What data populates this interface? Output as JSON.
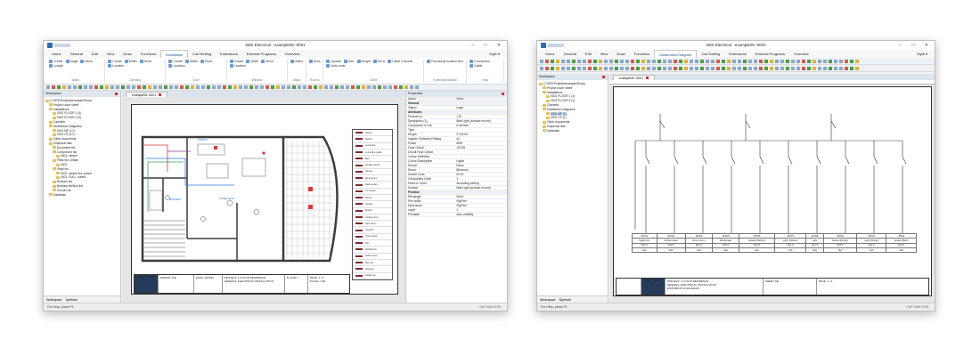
{
  "window_a": {
    "title": "SEE Electrical - example05 -0001",
    "window_controls": "– □ ✕",
    "menu": [
      {
        "label": "Home",
        "active": false
      },
      {
        "label": "General",
        "active": false
      },
      {
        "label": "Edit",
        "active": false
      },
      {
        "label": "View",
        "active": false
      },
      {
        "label": "Draw",
        "active": false
      },
      {
        "label": "Functions",
        "active": false
      },
      {
        "label": "Installation",
        "active": true
      },
      {
        "label": "Cad Setting",
        "active": false
      },
      {
        "label": "Extensions",
        "active": false
      },
      {
        "label": "External Programs",
        "active": false
      },
      {
        "label": "Overview",
        "active": false
      }
    ],
    "style_label": "Style ▾",
    "ribbon_groups": [
      {
        "label": "Walls",
        "buttons": [
          "Create",
          "Angle",
          "Move",
          "Length"
        ]
      },
      {
        "label": "Opening",
        "buttons": [
          "Create",
          "Width",
          "Move",
          "Location"
        ]
      },
      {
        "label": "Door",
        "buttons": [
          "Create",
          "Width",
          "Move",
          "Location"
        ]
      },
      {
        "label": "Window",
        "buttons": [
          "Create",
          "Width",
          "Move",
          "Location"
        ]
      },
      {
        "label": "Stairs",
        "buttons": [
          "Stairs"
        ]
      },
      {
        "label": "Rooms",
        "buttons": [
          "Area"
        ]
      },
      {
        "label": "Cable",
        "buttons": [
          "Update",
          "Size",
          "Height",
          "Set A",
          "Cable Channel",
          "Auto route"
        ]
      },
      {
        "label": "Functional location",
        "buttons": [
          "Functional location Box"
        ]
      },
      {
        "label": "View",
        "buttons": [
          "Connection",
          "Cable"
        ]
      }
    ],
    "workspace": {
      "title": "Workspace",
      "tree": [
        {
          "label": "C:\\SEE\\Projects\\example05.sep",
          "level": 0,
          "selected": false
        },
        {
          "label": "Project cover sheet",
          "level": 1,
          "selected": false
        },
        {
          "label": "Installations",
          "level": 1,
          "selected": false
        },
        {
          "label": "0001 FLOOR 1 (0)",
          "level": 2,
          "selected": false
        },
        {
          "label": "0002 FLOOR 2 (0)",
          "level": 2,
          "selected": false
        },
        {
          "label": "Cabinets",
          "level": 1,
          "selected": false
        },
        {
          "label": "Distribution Diagrams",
          "level": 1,
          "selected": false
        },
        {
          "label": "0001 MF (1?)",
          "level": 2,
          "selected": false
        },
        {
          "label": "0002 GF (1?)",
          "level": 2,
          "selected": false
        },
        {
          "label": "Other documents",
          "level": 1,
          "selected": false
        },
        {
          "label": "Graphical lists",
          "level": 1,
          "selected": false
        },
        {
          "label": "Document list",
          "level": 2,
          "selected": false
        },
        {
          "label": "Component list",
          "level": 2,
          "selected": false
        },
        {
          "label": "0001, simple",
          "level": 3,
          "selected": false
        },
        {
          "label": "Parts list, simple",
          "level": 2,
          "selected": false
        },
        {
          "label": "0001",
          "level": 3,
          "selected": false
        },
        {
          "label": "Parts list",
          "level": 2,
          "selected": false
        },
        {
          "label": "0001, simple list, sorted",
          "level": 3,
          "selected": false
        },
        {
          "label": "0001, FULL, sorted",
          "level": 3,
          "selected": false
        },
        {
          "label": "Bulbous list",
          "level": 2,
          "selected": false
        },
        {
          "label": "Bulbous list/Non list",
          "level": 2,
          "selected": false
        },
        {
          "label": "Circuit List",
          "level": 2,
          "selected": false
        },
        {
          "label": "Database",
          "level": 1,
          "selected": false
        }
      ],
      "tabs": [
        "Workspace",
        "Symbols"
      ]
    },
    "doc_tab": "example05 -0001",
    "plan_labels": [
      "Bedroom",
      "Living room",
      "Kitchen"
    ],
    "legend_rows": [
      "Socket",
      "Switch",
      "Luminaire",
      "Luminaire (wall)",
      "Bell",
      "Double socket",
      "Sensor",
      "Emergency",
      "Data socket",
      "TV socket",
      "Phone",
      "Smoke",
      "Motion",
      "Ceiling lamp",
      "Spot lamp",
      "Junction",
      "Thermostat",
      "Fan",
      "Distribution",
      "Cable route",
      "Bus line",
      "Antenna",
      "Cable tray"
    ],
    "properties": {
      "title": "Properties",
      "header": [
        "Name",
        "Value"
      ],
      "rows": [
        {
          "type": "sect",
          "name": "General",
          "value": ""
        },
        {
          "type": "row",
          "name": "Object",
          "value": "Layer"
        },
        {
          "type": "sect",
          "name": "Attributes",
          "value": ""
        },
        {
          "type": "row",
          "name": "Product no.",
          "value": "-C8"
        },
        {
          "type": "row",
          "name": "Description (1)",
          "value": "Wall Light (surface mount)"
        },
        {
          "type": "row",
          "name": "Component in List",
          "value": "in all lists"
        },
        {
          "type": "row",
          "name": "Type",
          "value": ""
        },
        {
          "type": "row",
          "name": "Height",
          "value": "2 100,00"
        },
        {
          "type": "row",
          "name": "Ingress Protection Rating",
          "value": "44"
        },
        {
          "type": "row",
          "name": "Power",
          "value": "60W"
        },
        {
          "type": "row",
          "name": "Fuse Circuit",
          "value": "-B7/08"
        },
        {
          "type": "row",
          "name": "Circuit Fuse Circuit",
          "value": ""
        },
        {
          "type": "row",
          "name": "Colour Definition",
          "value": ""
        },
        {
          "type": "row",
          "name": "Colour Description",
          "value": "Lights"
        },
        {
          "type": "row",
          "name": "Device",
          "value": "Dev/s"
        },
        {
          "type": "row",
          "name": "Room",
          "value": "Bedroom"
        },
        {
          "type": "row",
          "name": "Socket Code",
          "value": "00:00"
        },
        {
          "type": "row",
          "name": "Component Code",
          "value": "1"
        },
        {
          "type": "row",
          "name": "Plane in Level",
          "value": "According setting"
        },
        {
          "type": "row",
          "name": "Symbol",
          "value": "Wall Light (surface mount)"
        },
        {
          "type": "sect",
          "name": "Position",
          "value": ""
        },
        {
          "type": "row",
          "name": "Rectangle",
          "value": "Solid"
        },
        {
          "type": "row",
          "name": "Pen width",
          "value": "*ByPen*"
        },
        {
          "type": "row",
          "name": "Dimension",
          "value": "*ByPen*"
        },
        {
          "type": "row",
          "name": "Layer",
          "value": "1"
        },
        {
          "type": "row",
          "name": "Printable",
          "value": "Auto visibility"
        }
      ]
    },
    "title_block": {
      "logo": "IGE+XAO",
      "fields": [
        "DRAWN: IGE",
        "DATE: 18/2016",
        "PROJECT: 1 FLOOR RESIDENCE",
        "GENERAL ELECTRICAL INSTALLATION",
        "FLOOR 1",
        "PAGE: 1 / 2",
        "SCALE: 1:50"
      ]
    },
    "status": "For Help, press F1",
    "status_right": "CAP  NUM  SCRL"
  },
  "window_b": {
    "title": "SEE Electrical - example05 -0001",
    "window_controls": "– □ ✕",
    "menu": [
      {
        "label": "Home",
        "active": false
      },
      {
        "label": "General",
        "active": false
      },
      {
        "label": "Edit",
        "active": false
      },
      {
        "label": "View",
        "active": false
      },
      {
        "label": "Draw",
        "active": false
      },
      {
        "label": "Functions",
        "active": false
      },
      {
        "label": "Distribution Diagram",
        "active": true
      },
      {
        "label": "Cad Setting",
        "active": false
      },
      {
        "label": "Extensions",
        "active": false
      },
      {
        "label": "External Programs",
        "active": false
      },
      {
        "label": "Overview",
        "active": false
      }
    ],
    "style_label": "Style ▾",
    "workspace": {
      "title": "Workspace",
      "tree": [
        {
          "label": "C:\\SEE\\Projects\\example05.sep",
          "level": 0,
          "selected": false
        },
        {
          "label": "Project cover sheet",
          "level": 1,
          "selected": false
        },
        {
          "label": "Installations",
          "level": 1,
          "selected": false
        },
        {
          "label": "0001 FLOOR 1 (1)",
          "level": 2,
          "selected": false
        },
        {
          "label": "0002 FLOOR 2 (1)",
          "level": 2,
          "selected": false
        },
        {
          "label": "Cabinets",
          "level": 1,
          "selected": false
        },
        {
          "label": "Distribution Diagrams",
          "level": 1,
          "selected": false
        },
        {
          "label": "0001 MF (1)",
          "level": 2,
          "selected": true
        },
        {
          "label": "0002 GF (1)",
          "level": 2,
          "selected": false
        },
        {
          "label": "Other documents",
          "level": 1,
          "selected": false
        },
        {
          "label": "Graphical lists",
          "level": 1,
          "selected": false
        },
        {
          "label": "Database",
          "level": 1,
          "selected": false
        }
      ],
      "tabs": [
        "Workspace",
        "Symbols"
      ]
    },
    "doc_tab": "example05 -0001",
    "circuit_table": {
      "rows": [
        [
          "-B7/02",
          "-B7/03",
          "-B7/04",
          "-B7/05",
          "-B7/06",
          "-B7/07",
          "-B7/08",
          "-B7/09",
          "-B7/10",
          "-B7/11"
        ],
        [
          "Supply 1/1",
          "Kitchen Heat",
          "Room Oven",
          "Refrigerator",
          "Socket (Kitchen)",
          "Light (Kitchen)",
          "Light",
          "Socket (Dining)",
          "Light (Dining)",
          "Socket (Bath)"
        ],
        [
          "3G2.5",
          "3G2.5",
          "5G2.5",
          "3G2.5",
          "3G2.5",
          "3G1.5",
          "3G1.5",
          "3G2.5",
          "3G1.5",
          "3G2.5"
        ],
        [
          "16A",
          "16A",
          "16A",
          "16A",
          "16A",
          "10A",
          "10A",
          "16A",
          "10A",
          "16A"
        ]
      ]
    },
    "title_block": {
      "logo": "IGE+XAO",
      "fields": [
        "PROJECT: 1 FLOOR RESIDENCE",
        "GENERAL ELECTRICAL INSTALLATION",
        "DISTRIBUTION DIAGRAM",
        "SHEET: MF",
        "PAGE: 1 / 2"
      ]
    },
    "status": "For Help, press F1",
    "status_right": "CAP  NUM  SCRL"
  },
  "colors": {
    "accent": "#2b6cb0",
    "title_logo_bg": "#263a59",
    "wire": "#333333",
    "plan_wall": "#3c3c3c",
    "plan_blue": "#2e7bd6",
    "plan_green": "#3da35a",
    "plan_red": "#d23c3c"
  }
}
